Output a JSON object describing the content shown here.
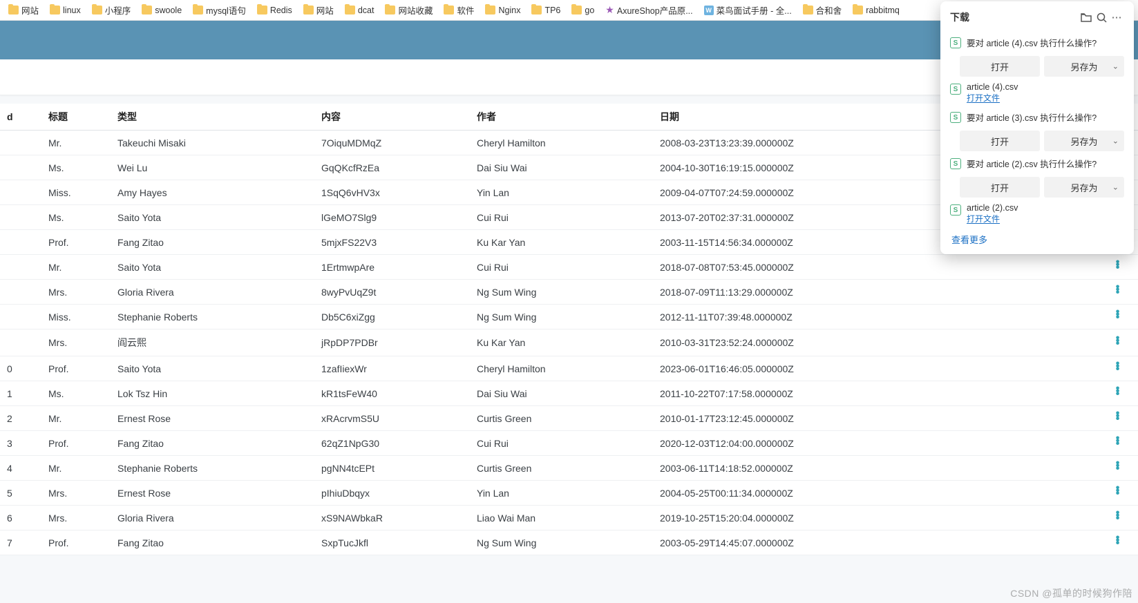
{
  "bookmarks": [
    {
      "icon": "folder",
      "label": "网站"
    },
    {
      "icon": "folder",
      "label": "linux"
    },
    {
      "icon": "folder",
      "label": "小程序"
    },
    {
      "icon": "folder",
      "label": "swoole"
    },
    {
      "icon": "folder",
      "label": "mysql语句"
    },
    {
      "icon": "folder",
      "label": "Redis"
    },
    {
      "icon": "folder",
      "label": "网站"
    },
    {
      "icon": "folder",
      "label": "dcat"
    },
    {
      "icon": "folder",
      "label": "网站收藏"
    },
    {
      "icon": "folder",
      "label": "软件"
    },
    {
      "icon": "folder",
      "label": "Nginx"
    },
    {
      "icon": "folder",
      "label": "TP6"
    },
    {
      "icon": "folder",
      "label": "go"
    },
    {
      "icon": "star",
      "label": "AxureShop产品原..."
    },
    {
      "icon": "book",
      "label": "菜鸟面试手册 - 全..."
    },
    {
      "icon": "folder",
      "label": "合和舍"
    },
    {
      "icon": "folder",
      "label": "rabbitmq"
    }
  ],
  "table": {
    "headers": {
      "idx": "d",
      "title": "标题",
      "type": "类型",
      "content": "内容",
      "author": "作者",
      "date": "日期"
    },
    "rows": [
      {
        "idx": "",
        "title": "Mr.",
        "type": "Takeuchi Misaki",
        "content": "7OiquMDMqZ",
        "author": "Cheryl Hamilton",
        "date": "2008-03-23T13:23:39.000000Z"
      },
      {
        "idx": "",
        "title": "Ms.",
        "type": "Wei Lu",
        "content": "GqQKcfRzEa",
        "author": "Dai Siu Wai",
        "date": "2004-10-30T16:19:15.000000Z"
      },
      {
        "idx": "",
        "title": "Miss.",
        "type": "Amy Hayes",
        "content": "1SqQ6vHV3x",
        "author": "Yin Lan",
        "date": "2009-04-07T07:24:59.000000Z"
      },
      {
        "idx": "",
        "title": "Ms.",
        "type": "Saito Yota",
        "content": "lGeMO7Slg9",
        "author": "Cui Rui",
        "date": "2013-07-20T02:37:31.000000Z"
      },
      {
        "idx": "",
        "title": "Prof.",
        "type": "Fang Zitao",
        "content": "5mjxFS22V3",
        "author": "Ku Kar Yan",
        "date": "2003-11-15T14:56:34.000000Z"
      },
      {
        "idx": "",
        "title": "Mr.",
        "type": "Saito Yota",
        "content": "1ErtmwpAre",
        "author": "Cui Rui",
        "date": "2018-07-08T07:53:45.000000Z"
      },
      {
        "idx": "",
        "title": "Mrs.",
        "type": "Gloria Rivera",
        "content": "8wyPvUqZ9t",
        "author": "Ng Sum Wing",
        "date": "2018-07-09T11:13:29.000000Z"
      },
      {
        "idx": "",
        "title": "Miss.",
        "type": "Stephanie Roberts",
        "content": "Db5C6xiZgg",
        "author": "Ng Sum Wing",
        "date": "2012-11-11T07:39:48.000000Z"
      },
      {
        "idx": "",
        "title": "Mrs.",
        "type": "阎云熙",
        "content": "jRpDP7PDBr",
        "author": "Ku Kar Yan",
        "date": "2010-03-31T23:52:24.000000Z"
      },
      {
        "idx": "0",
        "title": "Prof.",
        "type": "Saito Yota",
        "content": "1zafIiexWr",
        "author": "Cheryl Hamilton",
        "date": "2023-06-01T16:46:05.000000Z"
      },
      {
        "idx": "1",
        "title": "Ms.",
        "type": "Lok Tsz Hin",
        "content": "kR1tsFeW40",
        "author": "Dai Siu Wai",
        "date": "2011-10-22T07:17:58.000000Z"
      },
      {
        "idx": "2",
        "title": "Mr.",
        "type": "Ernest Rose",
        "content": "xRAcrvmS5U",
        "author": "Curtis Green",
        "date": "2010-01-17T23:12:45.000000Z"
      },
      {
        "idx": "3",
        "title": "Prof.",
        "type": "Fang Zitao",
        "content": "62qZ1NpG30",
        "author": "Cui Rui",
        "date": "2020-12-03T12:04:00.000000Z"
      },
      {
        "idx": "4",
        "title": "Mr.",
        "type": "Stephanie Roberts",
        "content": "pgNN4tcEPt",
        "author": "Curtis Green",
        "date": "2003-06-11T14:18:52.000000Z"
      },
      {
        "idx": "5",
        "title": "Mrs.",
        "type": "Ernest Rose",
        "content": "pIhiuDbqyx",
        "author": "Yin Lan",
        "date": "2004-05-25T00:11:34.000000Z"
      },
      {
        "idx": "6",
        "title": "Mrs.",
        "type": "Gloria Rivera",
        "content": "xS9NAWbkaR",
        "author": "Liao Wai Man",
        "date": "2019-10-25T15:20:04.000000Z"
      },
      {
        "idx": "7",
        "title": "Prof.",
        "type": "Fang Zitao",
        "content": "SxpTucJkfl",
        "author": "Ng Sum Wing",
        "date": "2003-05-29T14:45:07.000000Z"
      }
    ]
  },
  "downloads": {
    "title": "下载",
    "open_btn": "打开",
    "saveas_btn": "另存为",
    "open_file": "打开文件",
    "see_more": "查看更多",
    "items": [
      {
        "kind": "prompt",
        "text": "要对 article (4).csv 执行什么操作?"
      },
      {
        "kind": "done",
        "name": "article (4).csv"
      },
      {
        "kind": "prompt",
        "text": "要对 article (3).csv 执行什么操作?"
      },
      {
        "kind": "prompt",
        "text": "要对 article (2).csv 执行什么操作?"
      },
      {
        "kind": "done",
        "name": "article (2).csv"
      }
    ]
  },
  "watermark": "CSDN @孤单的时候狗作陪"
}
